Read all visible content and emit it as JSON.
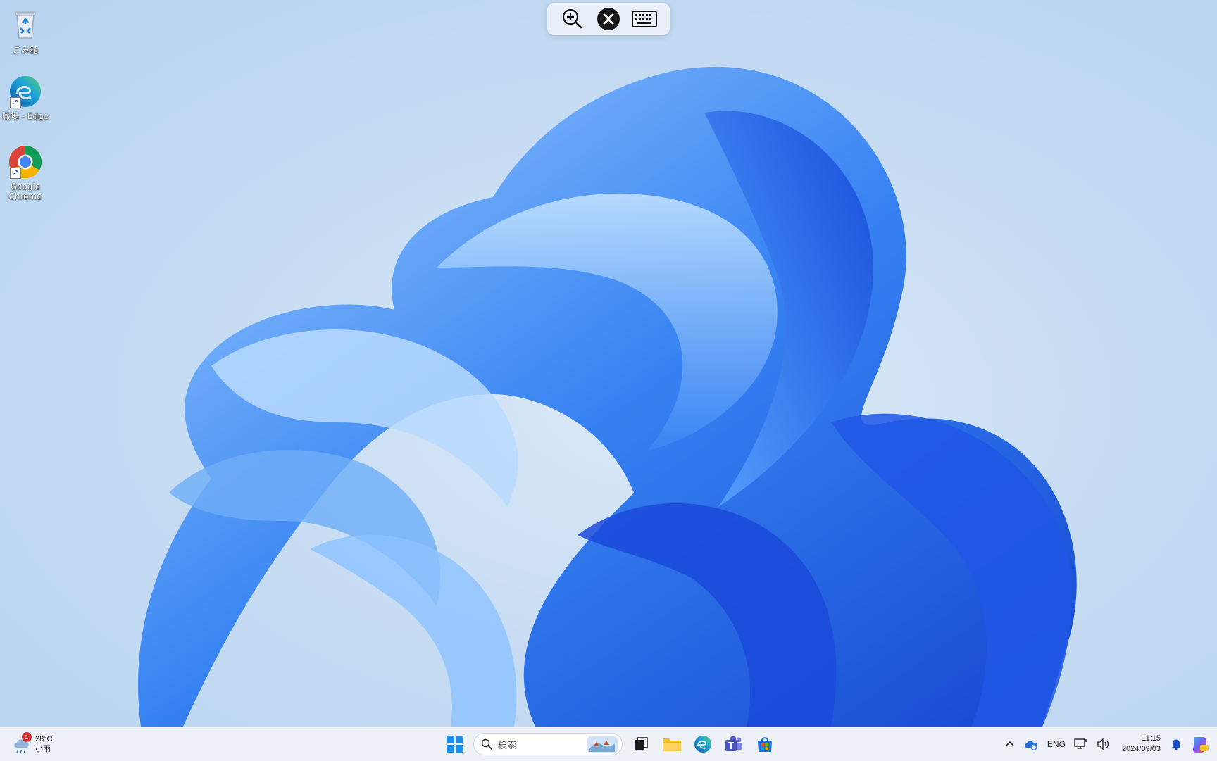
{
  "desktop": {
    "icons": [
      {
        "label": "ごみ箱",
        "icon": "recycle-bin-icon"
      },
      {
        "label": "職場 - Edge",
        "icon": "edge-icon"
      },
      {
        "label": "Google Chrome",
        "icon": "chrome-icon"
      }
    ]
  },
  "remote_toolbar": {
    "buttons": [
      "zoom-in-icon",
      "remote-connection-icon",
      "keyboard-icon"
    ]
  },
  "taskbar": {
    "weather": {
      "badge": "1",
      "temperature": "28°C",
      "condition": "小雨"
    },
    "search": {
      "placeholder": "検索"
    },
    "pinned": [
      "start-icon",
      "task-view-icon",
      "file-explorer-icon",
      "edge-icon",
      "teams-icon",
      "store-icon"
    ],
    "tray": {
      "language": "ENG",
      "time": "11:15",
      "date": "2024/09/03"
    }
  },
  "colors": {
    "accent": "#1f6fe0",
    "taskbar_bg": "#eef2f8"
  }
}
